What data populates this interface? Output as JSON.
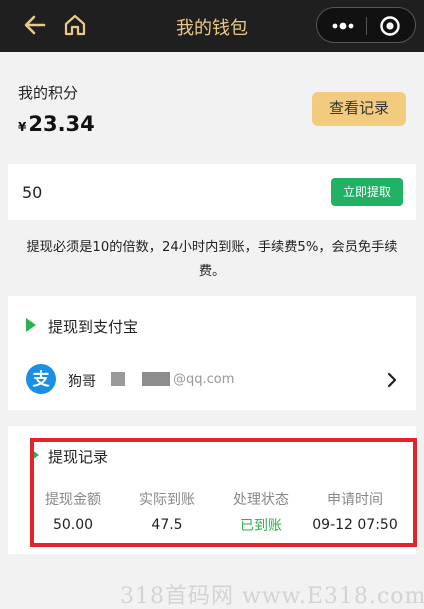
{
  "navbar": {
    "title": "我的钱包",
    "back_icon": "back-arrow-icon",
    "home_icon": "home-icon",
    "more_icon": "more-dots-icon",
    "close_icon": "target-close-icon",
    "title_color": "#e9c98a",
    "background": "#1f1f1f"
  },
  "points": {
    "label": "我的积分",
    "currency": "¥",
    "value": "23.34",
    "view_records_label": "查看记录",
    "button_color": "#f2cb7f"
  },
  "withdraw": {
    "amount_value": "50",
    "button_label": "立即提取",
    "button_color": "#21b165"
  },
  "notice": {
    "line1": "提现必须是10的倍数，24小时内到账，手续费5%，会员免手续",
    "line2": "费。"
  },
  "alipay": {
    "section_title": "提现到支付宝",
    "logo_icon": "alipay-icon",
    "logo_glyph": "支",
    "account_name": "狗哥",
    "account_domain": "@qq.com",
    "chevron_icon": "chevron-right-icon",
    "brand_color": "#1a8fe3"
  },
  "records": {
    "section_title": "提现记录",
    "headers": [
      "提现金额",
      "实际到账",
      "处理状态",
      "申请时间"
    ],
    "rows": [
      [
        "50.00",
        "47.5",
        "已到账",
        "09-12 07:50"
      ]
    ],
    "status_color": "#2bb24c",
    "highlight_color": "#e3252a"
  },
  "watermark": {
    "text": "318首码网 www.E318.com"
  }
}
